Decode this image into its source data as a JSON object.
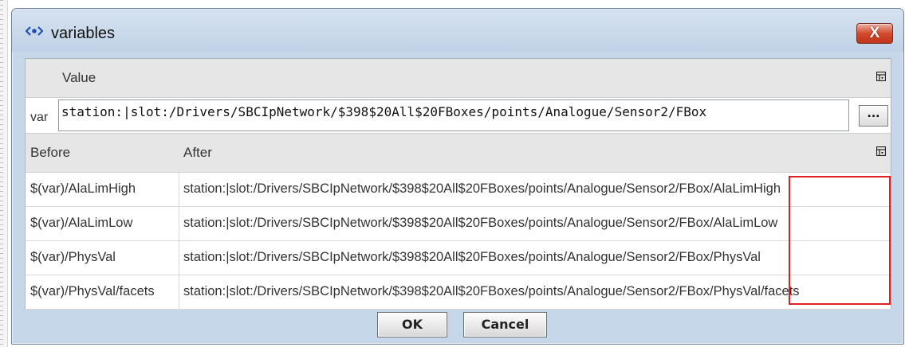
{
  "window": {
    "title": "variables",
    "close_label": "X"
  },
  "value_panel": {
    "header": "Value",
    "var_label": "var",
    "var_value": "station:|slot:/Drivers/SBCIpNetwork/$398$20All$20FBoxes/points/Analogue/Sensor2/FBox",
    "browse_label": "..."
  },
  "table": {
    "columns": [
      "Before",
      "After"
    ],
    "rows": [
      {
        "before": "$(var)/AlaLimHigh",
        "after": "station:|slot:/Drivers/SBCIpNetwork/$398$20All$20FBoxes/points/Analogue/Sensor2/FBox/AlaLimHigh"
      },
      {
        "before": "$(var)/AlaLimLow",
        "after": "station:|slot:/Drivers/SBCIpNetwork/$398$20All$20FBoxes/points/Analogue/Sensor2/FBox/AlaLimLow"
      },
      {
        "before": "$(var)/PhysVal",
        "after": "station:|slot:/Drivers/SBCIpNetwork/$398$20All$20FBoxes/points/Analogue/Sensor2/FBox/PhysVal"
      },
      {
        "before": "$(var)/PhysVal/facets",
        "after": "station:|slot:/Drivers/SBCIpNetwork/$398$20All$20FBoxes/points/Analogue/Sensor2/FBox/PhysVal/facets"
      }
    ]
  },
  "buttons": {
    "ok": "OK",
    "cancel": "Cancel"
  },
  "icons": {
    "title": "variables-icon",
    "close": "close-icon",
    "column_chooser": "table-options-icon"
  },
  "colors": {
    "title_bar": "#c6d7e9",
    "close_button": "#d34a2d",
    "header_gray": "#e6e6e6",
    "highlight": "#e02020"
  }
}
